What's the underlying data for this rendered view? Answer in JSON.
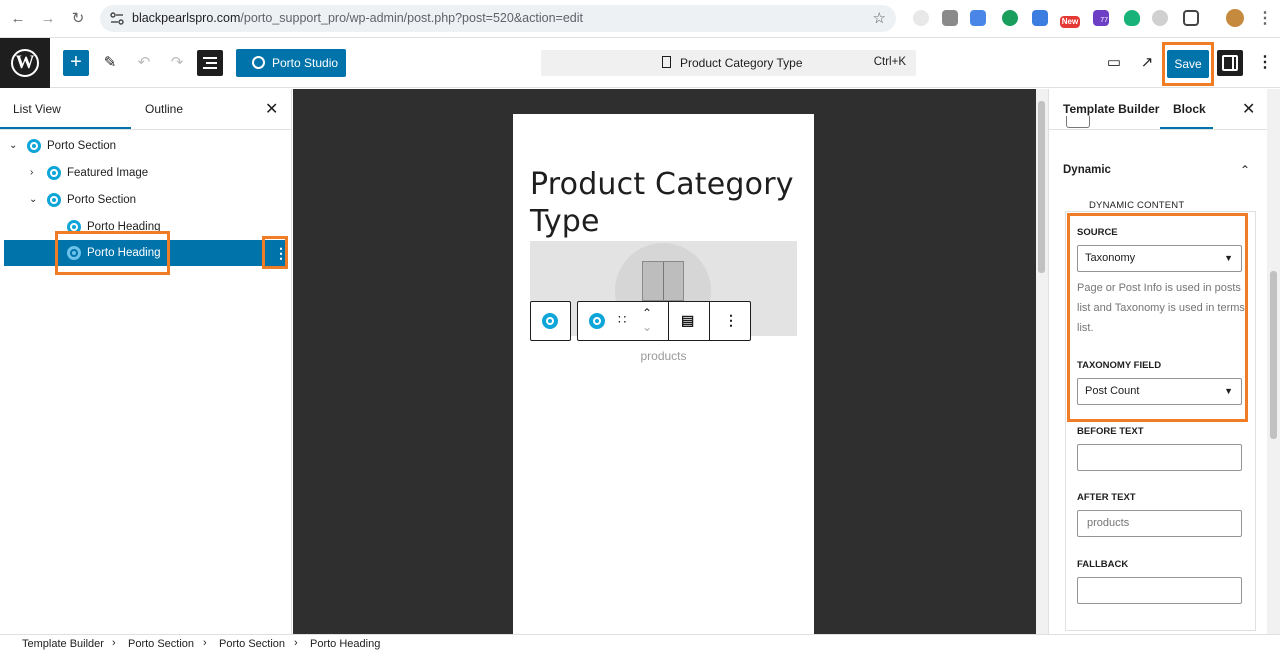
{
  "browser": {
    "url_host": "blackpearlspro.com",
    "url_path": "/porto_support_pro/wp-admin/post.php?post=520&action=edit",
    "ext_badge": "New",
    "ext_count": "77"
  },
  "header": {
    "studio_label": "Porto Studio",
    "document_title": "Product Category Type",
    "shortcut": "Ctrl+K",
    "save_label": "Save"
  },
  "left_panel": {
    "tabs": [
      "List View",
      "Outline"
    ],
    "tree": [
      {
        "label": "Porto Section",
        "depth": 0,
        "expanded": true
      },
      {
        "label": "Featured Image",
        "depth": 1,
        "expanded": false
      },
      {
        "label": "Porto Section",
        "depth": 1,
        "expanded": true
      },
      {
        "label": "Porto Heading",
        "depth": 2
      },
      {
        "label": "Porto Heading",
        "depth": 2,
        "selected": true
      }
    ]
  },
  "canvas": {
    "heading": "Product Category Type",
    "after_text": "products"
  },
  "right_panel": {
    "tabs": [
      "Template Builder",
      "Block"
    ],
    "active_tab": "Block",
    "section_title": "Dynamic",
    "fieldset_legend": "DYNAMIC CONTENT",
    "source_label": "SOURCE",
    "source_value": "Taxonomy",
    "help_text": "Page or Post Info is used in posts list and Taxonomy is used in terms list.",
    "taxonomy_field_label": "TAXONOMY FIELD",
    "taxonomy_field_value": "Post Count",
    "before_text_label": "BEFORE TEXT",
    "before_text_value": "",
    "after_text_label": "AFTER TEXT",
    "after_text_value": "products",
    "fallback_label": "FALLBACK",
    "fallback_value": ""
  },
  "breadcrumb": [
    "Template Builder",
    "Porto Section",
    "Porto Section",
    "Porto Heading"
  ],
  "colors": {
    "accent": "#0073aa",
    "highlight": "#f07c26",
    "porto_icon": "#0ea5d9"
  }
}
